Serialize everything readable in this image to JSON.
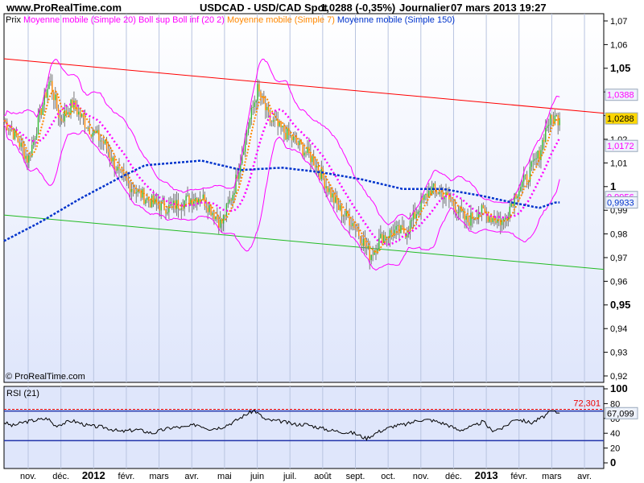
{
  "header": {
    "site": "www.ProRealTime.com",
    "instrument": "USDCAD - USD/CAD Spot",
    "last": "1,0288 (-0,35%)",
    "period": "Journalier",
    "datetime": "07 mars 2013 19:27"
  },
  "legend": [
    {
      "text": "Prix",
      "color": "#000000"
    },
    {
      "text": "Moyenne mobile (Simple 20)",
      "color": "#ff00ff"
    },
    {
      "text": "Boll sup Boll inf (20 2)",
      "color": "#ff00ff"
    },
    {
      "text": "Moyenne mobile (Simple 7)",
      "color": "#ff8800"
    },
    {
      "text": "Moyenne mobile (Simple 150)",
      "color": "#0033cc"
    }
  ],
  "copyright": "© ProRealTime.com",
  "chart_data": {
    "type": "candlestick",
    "title": "USDCAD - USD/CAD Spot",
    "x_ticks": [
      {
        "label": "nov.",
        "t": 0
      },
      {
        "label": "déc.",
        "t": 1
      },
      {
        "label": "2012",
        "t": 2,
        "bold": true
      },
      {
        "label": "févr.",
        "t": 3
      },
      {
        "label": "mars",
        "t": 4
      },
      {
        "label": "avr.",
        "t": 5
      },
      {
        "label": "mai",
        "t": 6
      },
      {
        "label": "juin",
        "t": 7
      },
      {
        "label": "juil.",
        "t": 8
      },
      {
        "label": "août",
        "t": 9
      },
      {
        "label": "sept.",
        "t": 10
      },
      {
        "label": "oct.",
        "t": 11
      },
      {
        "label": "nov.",
        "t": 12
      },
      {
        "label": "déc.",
        "t": 13
      },
      {
        "label": "2013",
        "t": 14,
        "bold": true
      },
      {
        "label": "févr.",
        "t": 15
      },
      {
        "label": "mars",
        "t": 16
      },
      {
        "label": "avr.",
        "t": 17
      }
    ],
    "y_ticks": [
      "1,07",
      "1,06",
      "1,05",
      "1,04",
      "1,03",
      "1,02",
      "1,01",
      "1",
      "0,99",
      "0,98",
      "0,97",
      "0,96",
      "0,95",
      "0,94",
      "0,93",
      "0,92"
    ],
    "ylim": [
      0.92,
      1.07
    ],
    "close_anchors": [
      [
        -0.74,
        1.028
      ],
      [
        -0.37,
        1.021
      ],
      [
        0,
        1.011
      ],
      [
        0.37,
        1.031
      ],
      [
        0.66,
        1.045
      ],
      [
        0.98,
        1.028
      ],
      [
        1.35,
        1.035
      ],
      [
        1.84,
        1.025
      ],
      [
        2.34,
        1.018
      ],
      [
        2.83,
        1.004
      ],
      [
        3.32,
        0.998
      ],
      [
        3.81,
        0.993
      ],
      [
        4.31,
        0.991
      ],
      [
        4.8,
        0.994
      ],
      [
        5.29,
        0.996
      ],
      [
        5.66,
        0.989
      ],
      [
        5.9,
        0.984
      ],
      [
        6.27,
        0.998
      ],
      [
        6.64,
        1.021
      ],
      [
        7.01,
        1.041
      ],
      [
        7.38,
        1.028
      ],
      [
        7.75,
        1.024
      ],
      [
        8.24,
        1.018
      ],
      [
        8.73,
        1.011
      ],
      [
        9.1,
        1.001
      ],
      [
        9.47,
        0.991
      ],
      [
        9.96,
        0.984
      ],
      [
        10.45,
        0.971
      ],
      [
        10.82,
        0.979
      ],
      [
        11.19,
        0.981
      ],
      [
        11.56,
        0.981
      ],
      [
        11.93,
        0.991
      ],
      [
        12.3,
        0.999
      ],
      [
        12.67,
        0.997
      ],
      [
        13.04,
        0.992
      ],
      [
        13.41,
        0.985
      ],
      [
        13.78,
        0.99
      ],
      [
        14.15,
        0.987
      ],
      [
        14.52,
        0.985
      ],
      [
        14.88,
        0.997
      ],
      [
        15.25,
        1.004
      ],
      [
        15.62,
        1.014
      ],
      [
        15.87,
        1.027
      ],
      [
        16.11,
        1.029
      ],
      [
        16.24,
        1.0288
      ]
    ],
    "ma150_anchors": [
      [
        -0.74,
        0.977
      ],
      [
        0.37,
        0.985
      ],
      [
        1.6,
        0.995
      ],
      [
        2.83,
        1.004
      ],
      [
        3.57,
        1.009
      ],
      [
        5.29,
        1.011
      ],
      [
        6.52,
        1.007
      ],
      [
        7.75,
        1.008
      ],
      [
        8.98,
        1.006
      ],
      [
        10.21,
        1.003
      ],
      [
        11.44,
        0.999
      ],
      [
        12.67,
        0.999
      ],
      [
        13.9,
        0.996
      ],
      [
        14.88,
        0.993
      ],
      [
        15.62,
        0.991
      ],
      [
        16.11,
        0.9933
      ]
    ],
    "trendlines": [
      {
        "color": "#ff0000",
        "from": [
          -0.74,
          1.054
        ],
        "to": [
          17.6,
          1.031
        ]
      },
      {
        "color": "#22bb22",
        "from": [
          -0.74,
          0.988
        ],
        "to": [
          17.6,
          0.965
        ]
      }
    ],
    "price_labels": [
      {
        "text": "1,0388",
        "value": 1.0388,
        "color": "#ff00ff"
      },
      {
        "text": "1,0288",
        "value": 1.0288,
        "color": "#000000",
        "bg": "#ffd700"
      },
      {
        "text": "1,0172",
        "value": 1.0172,
        "color": "#ff00ff"
      },
      {
        "text": "0,9956",
        "value": 0.9956,
        "color": "#ff00ff"
      },
      {
        "text": "0,9933",
        "value": 0.9933,
        "color": "#0033cc"
      }
    ],
    "rsi": {
      "title": "RSI (21)",
      "y_ticks": [
        "100",
        "80",
        "60",
        "40",
        "20",
        "0"
      ],
      "ylim": [
        0,
        100
      ],
      "levels": [
        70,
        30
      ],
      "max_line": 72.301,
      "max_label": "72,301",
      "last_label": "67,099",
      "anchors": [
        [
          -0.74,
          55
        ],
        [
          -0.49,
          50
        ],
        [
          -0.12,
          55
        ],
        [
          0.12,
          57
        ],
        [
          0.61,
          60
        ],
        [
          0.81,
          50
        ],
        [
          1.35,
          57
        ],
        [
          1.84,
          50
        ],
        [
          2.34,
          48
        ],
        [
          2.83,
          42
        ],
        [
          3.32,
          45
        ],
        [
          3.81,
          40
        ],
        [
          4.06,
          44
        ],
        [
          4.43,
          48
        ],
        [
          4.8,
          48
        ],
        [
          5.17,
          52
        ],
        [
          5.54,
          46
        ],
        [
          5.9,
          48
        ],
        [
          6.27,
          55
        ],
        [
          6.64,
          65
        ],
        [
          6.91,
          71
        ],
        [
          7.26,
          58
        ],
        [
          7.75,
          56
        ],
        [
          8.12,
          52
        ],
        [
          8.49,
          52
        ],
        [
          8.86,
          48
        ],
        [
          9.23,
          44
        ],
        [
          9.59,
          42
        ],
        [
          9.96,
          40
        ],
        [
          10.33,
          33
        ],
        [
          10.7,
          42
        ],
        [
          11.19,
          50
        ],
        [
          11.56,
          52
        ],
        [
          11.93,
          58
        ],
        [
          12.3,
          58
        ],
        [
          12.79,
          52
        ],
        [
          13.16,
          44
        ],
        [
          13.65,
          50
        ],
        [
          13.9,
          56
        ],
        [
          14.15,
          44
        ],
        [
          14.52,
          47
        ],
        [
          14.88,
          60
        ],
        [
          15.37,
          54
        ],
        [
          15.74,
          62
        ],
        [
          15.99,
          70
        ],
        [
          16.24,
          67.1
        ]
      ]
    }
  }
}
